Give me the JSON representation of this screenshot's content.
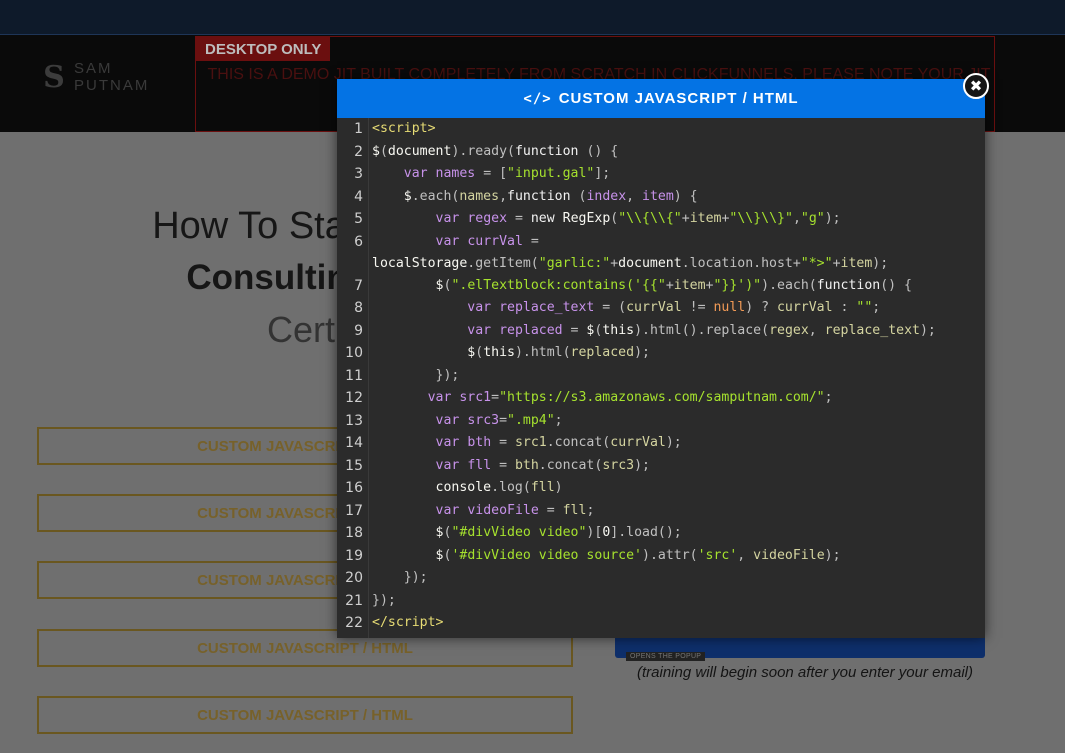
{
  "brand": {
    "logo_letter": "S",
    "logo_line1": "SAM",
    "logo_line2": "PUTNAM"
  },
  "notice": {
    "tag": "DESKTOP ONLY",
    "text": "THIS IS A DEMO JIT BUILT COMPLETELY FROM SCRATCH IN CLICKFUNNELS. PLEASE NOTE YOUR JIT WILL NOT..."
  },
  "headline": {
    "line1": "How To Start & Gr",
    "line2": "Consulting Fir",
    "line3": "Certi"
  },
  "blocks": [
    "CUSTOM JAVASCRIPT / HTML",
    "CUSTOM JAVASCRIPT / HTML",
    "CUSTOM JAVASCRIPT / HTML",
    "CUSTOM JAVASCRIPT / HTML",
    "CUSTOM JAVASCRIPT / HTML"
  ],
  "popup_tag": "OPENS THE POPUP",
  "training_note": "(training will begin soon after you enter your email)",
  "modal": {
    "title": "CUSTOM JAVASCRIPT / HTML",
    "icon": "code-icon",
    "close_icon": "close-icon",
    "line_numbers": [
      "1",
      "2",
      "3",
      "4",
      "5",
      "6",
      "7",
      "8",
      "9",
      "10",
      "11",
      "12",
      "13",
      "14",
      "15",
      "16",
      "17",
      "18",
      "19",
      "20",
      "21",
      "22"
    ]
  },
  "colors": {
    "modal_header": "#0473e4",
    "string": "#a6e22e",
    "variable": "#c792ea",
    "tag": "#e6db74"
  }
}
